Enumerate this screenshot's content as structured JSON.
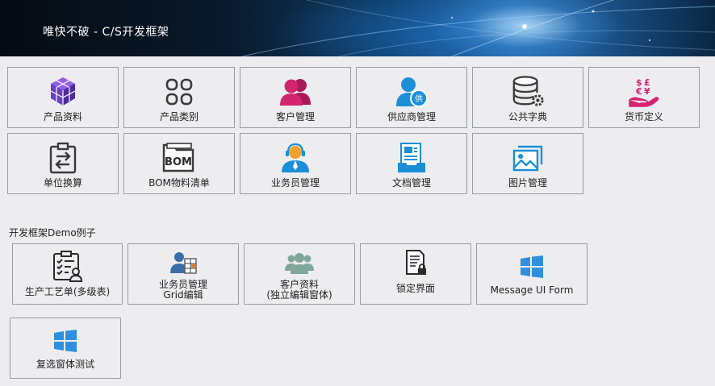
{
  "header": {
    "title": "唯快不破 - C/S开发框架"
  },
  "main_grid": [
    {
      "label": "产品资料",
      "icon": "cube-cluster-icon"
    },
    {
      "label": "产品类别",
      "icon": "category-grid-icon"
    },
    {
      "label": "客户管理",
      "icon": "users-icon"
    },
    {
      "label": "供应商管理",
      "icon": "supplier-user-icon"
    },
    {
      "label": "公共字典",
      "icon": "database-gear-icon"
    },
    {
      "label": "货币定义",
      "icon": "currency-hand-icon"
    },
    {
      "label": "单位换算",
      "icon": "unit-convert-icon"
    },
    {
      "label": "BOM物料清单",
      "icon": "bom-folder-icon"
    },
    {
      "label": "业务员管理",
      "icon": "salesperson-headset-icon"
    },
    {
      "label": "文档管理",
      "icon": "document-stack-icon"
    },
    {
      "label": "图片管理",
      "icon": "picture-icon"
    }
  ],
  "demo_section": {
    "label": "开发框架Demo例子",
    "items": [
      {
        "lines": [
          "生产工艺单(多级表)"
        ],
        "icon": "checklist-clipboard-icon"
      },
      {
        "lines": [
          "业务员管理",
          "Grid编辑"
        ],
        "icon": "user-grid-icon"
      },
      {
        "lines": [
          "客户资料",
          "(独立编辑窗体)"
        ],
        "icon": "customer-group-icon"
      },
      {
        "lines": [
          "锁定界面"
        ],
        "icon": "lock-document-icon"
      },
      {
        "lines": [
          "Message UI Form"
        ],
        "icon": "windows-logo-icon"
      },
      {
        "lines": [
          "复选窗体测试"
        ],
        "icon": "windows-logo-icon"
      }
    ]
  },
  "colors": {
    "accent_blue": "#1a8fd8",
    "purple": "#6a3fc4",
    "magenta": "#d3246e",
    "dark_gray": "#3a3a3a",
    "teal_gray": "#7fa89a",
    "windows_blue": "#2f8fde"
  }
}
